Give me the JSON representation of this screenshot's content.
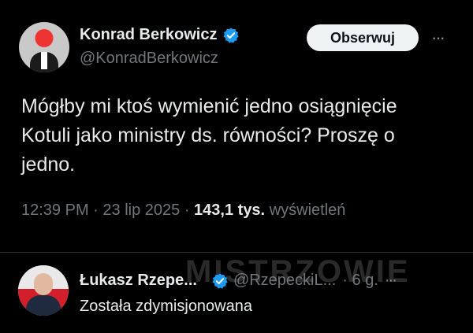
{
  "tweet": {
    "display_name": "Konrad Berkowicz",
    "handle": "@KonradBerkowicz",
    "follow_label": "Obserwuj",
    "more_label": "···",
    "text": "Mógłby mi ktoś wymienić jedno osiągnięcie Kotuli jako ministry ds. równości? Proszę o jedno.",
    "time": "12:39 PM",
    "sep": " · ",
    "date": "23 lip 2025",
    "views_count": "143,1 tys.",
    "views_label": "wyświetleń"
  },
  "reply": {
    "display_name": "Łukasz Rzepe...",
    "handle": "@RzepeckiL...",
    "time": "· 6 g.",
    "more_label": "···",
    "text": "Została zdymisjonowana"
  },
  "watermark": "MISTRZOWIE",
  "colors": {
    "background": "#000000",
    "verified": "#1d9bf0",
    "text": "#e7e9ea",
    "secondary": "#71767b"
  }
}
